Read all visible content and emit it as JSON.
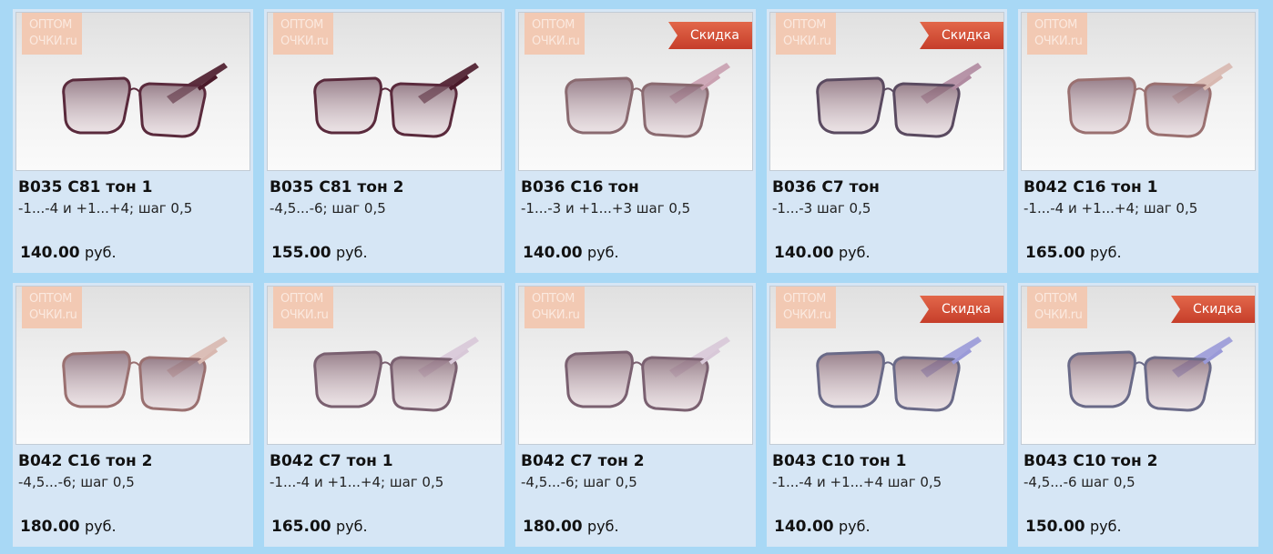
{
  "products": [
    {
      "title": "B035 C81 тон 1",
      "spec": "-1...-4 и +1...+4; шаг 0,5",
      "price": "140.00",
      "currency": "руб.",
      "sale": false,
      "logo": [
        "ОПТОМ",
        "ОЧКИ.ru"
      ],
      "frame_color": "#5a2a3c",
      "temple_color": "#4a1a2a"
    },
    {
      "title": "B035 C81 тон 2",
      "spec": "-4,5...-6; шаг 0,5",
      "price": "155.00",
      "currency": "руб.",
      "sale": false,
      "logo": [
        "ОПТОМ",
        "ОЧКИ.ru"
      ],
      "frame_color": "#5a2a3c",
      "temple_color": "#4a1a2a"
    },
    {
      "title": "B036 C16 тон",
      "spec": "-1...-3 и +1...+3 шаг 0,5",
      "price": "140.00",
      "currency": "руб.",
      "sale": true,
      "sale_label": "Скидка",
      "logo": [
        "ОПТОМ",
        "ОЧКИ.ru"
      ],
      "frame_color": "#8a6a70",
      "temple_color": "#c9a0b0"
    },
    {
      "title": "B036 C7 тон",
      "spec": "-1...-3 шаг 0,5",
      "price": "140.00",
      "currency": "руб.",
      "sale": true,
      "sale_label": "Скидка",
      "logo": [
        "ОПТОМ",
        "ОЧКИ.ru"
      ],
      "frame_color": "#5a4a60",
      "temple_color": "#b08aa0"
    },
    {
      "title": "B042 C16 тон 1",
      "spec": "-1...-4 и +1...+4; шаг 0,5",
      "price": "165.00",
      "currency": "руб.",
      "sale": false,
      "logo": [
        "ОПТОМ",
        "ОЧКИ.ru"
      ],
      "frame_color": "#9a7070",
      "temple_color": "#d8b8b0"
    },
    {
      "title": "B042 C16 тон 2",
      "spec": "-4,5...-6; шаг 0,5",
      "price": "180.00",
      "currency": "руб.",
      "sale": false,
      "logo": [
        "ОПТОМ",
        "ОЧКИ.ru"
      ],
      "frame_color": "#9a7070",
      "temple_color": "#d8b8b0"
    },
    {
      "title": "B042 C7 тон 1",
      "spec": "-1...-4 и +1...+4; шаг 0,5",
      "price": "165.00",
      "currency": "руб.",
      "sale": false,
      "logo": [
        "ОПТОМ",
        "ОЧКИ.ru"
      ],
      "frame_color": "#7a6070",
      "temple_color": "#d8c8d8"
    },
    {
      "title": "B042 C7 тон 2",
      "spec": "-4,5...-6; шаг 0,5",
      "price": "180.00",
      "currency": "руб.",
      "sale": false,
      "logo": [
        "ОПТОМ",
        "ОЧКИ.ru"
      ],
      "frame_color": "#7a6070",
      "temple_color": "#d8c8d8"
    },
    {
      "title": "B043 C10 тон 1",
      "spec": "-1...-4 и +1...+4 шаг 0,5",
      "price": "140.00",
      "currency": "руб.",
      "sale": true,
      "sale_label": "Скидка",
      "logo": [
        "ОПТОМ",
        "ОЧКИ.ru"
      ],
      "frame_color": "#6a6a88",
      "temple_color": "#9a9ad8"
    },
    {
      "title": "B043 C10 тон 2",
      "spec": "-4,5...-6 шаг 0,5",
      "price": "150.00",
      "currency": "руб.",
      "sale": true,
      "sale_label": "Скидка",
      "logo": [
        "ОПТОМ",
        "ОЧКИ.ru"
      ],
      "frame_color": "#6a6a88",
      "temple_color": "#9a9ad8"
    }
  ]
}
